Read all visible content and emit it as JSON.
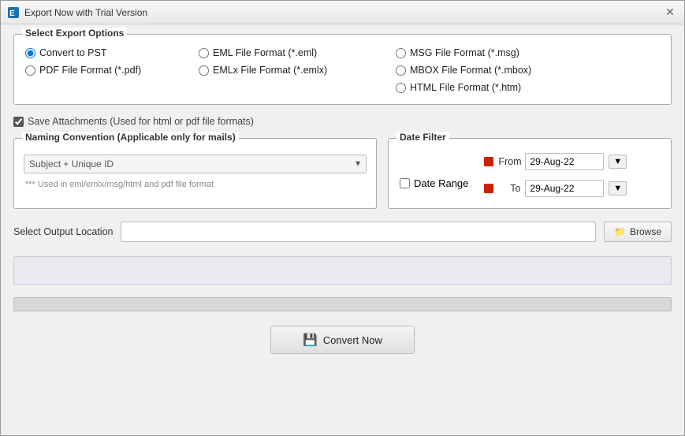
{
  "window": {
    "title": "Export Now with Trial Version",
    "close_label": "✕"
  },
  "export_options": {
    "legend": "Select Export Options",
    "options": [
      {
        "id": "pst",
        "label": "Convert to PST",
        "checked": true
      },
      {
        "id": "eml",
        "label": "EML File  Format (*.eml)",
        "checked": false
      },
      {
        "id": "msg",
        "label": "MSG File Format (*.msg)",
        "checked": false
      },
      {
        "id": "pdf",
        "label": "PDF File Format (*.pdf)",
        "checked": false
      },
      {
        "id": "emlx",
        "label": "EMLx File  Format (*.emlx)",
        "checked": false
      },
      {
        "id": "mbox",
        "label": "MBOX File Format (*.mbox)",
        "checked": false
      },
      {
        "id": "html",
        "label": "HTML File  Format (*.htm)",
        "checked": false
      }
    ]
  },
  "save_attachments": {
    "label": "Save Attachments (Used for html or pdf file formats)",
    "checked": true
  },
  "naming_convention": {
    "legend": "Naming Convention (Applicable only for mails)",
    "default_option": "Subject + Unique ID",
    "note": "*** Used in eml/emlx/msg/html and pdf file format"
  },
  "date_filter": {
    "legend": "Date Filter",
    "from_label": "From",
    "to_label": "To",
    "from_value": "29-Aug-22",
    "to_value": "29-Aug-22",
    "date_range_label": "Date Range"
  },
  "output": {
    "label": "Select Output Location",
    "placeholder": "",
    "browse_label": "Browse"
  },
  "convert_button": {
    "label": "Convert Now"
  }
}
